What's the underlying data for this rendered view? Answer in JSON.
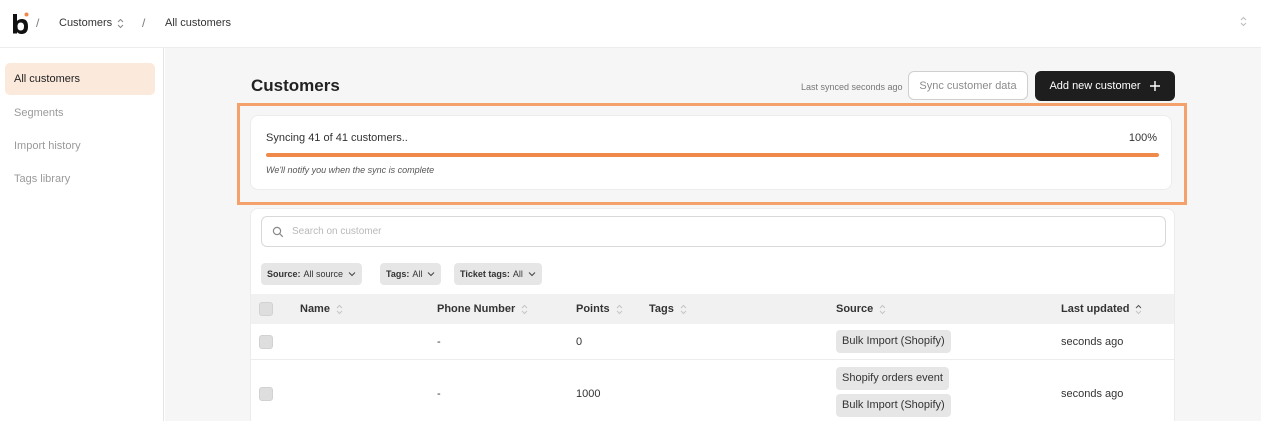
{
  "breadcrumb": {
    "separator": "/",
    "section": "Customers",
    "current": "All customers"
  },
  "colors": {
    "accent": "#f08a4b",
    "highlight": "#f5a16b",
    "sidebar_active_bg": "#fbe9dc",
    "primary_button_bg": "#1e1e1e"
  },
  "sidebar": {
    "items": [
      {
        "label": "All customers",
        "active": true
      },
      {
        "label": "Segments",
        "active": false
      },
      {
        "label": "Import history",
        "active": false
      },
      {
        "label": "Tags library",
        "active": false
      }
    ]
  },
  "header": {
    "title": "Customers",
    "last_synced": "Last synced seconds ago",
    "sync_button": "Sync customer data",
    "add_button": "Add new customer"
  },
  "sync_progress": {
    "label": "Syncing 41 of 41 customers..",
    "percent_text": "100%",
    "fraction": 1.0,
    "note": "We'll notify you when the sync is complete"
  },
  "search": {
    "placeholder": "Search on customer",
    "value": ""
  },
  "filters": [
    {
      "key": "Source:",
      "value": "All source"
    },
    {
      "key": "Tags:",
      "value": "All"
    },
    {
      "key": "Ticket tags:",
      "value": "All"
    }
  ],
  "table": {
    "columns": [
      "Name",
      "Phone Number",
      "Points",
      "Tags",
      "Source",
      "Last updated"
    ],
    "rows": [
      {
        "name": "",
        "phone": "-",
        "points": "0",
        "tags": "",
        "sources": [
          "Bulk Import (Shopify)"
        ],
        "updated": "seconds ago"
      },
      {
        "name": "",
        "phone": "-",
        "points": "1000",
        "tags": "",
        "sources": [
          "Shopify orders event",
          "Bulk Import (Shopify)"
        ],
        "updated": "seconds ago"
      }
    ]
  },
  "icons": {
    "logo": "brand-logo-b",
    "search": "search-icon",
    "plus": "plus-icon",
    "chevron": "chevron-down-icon",
    "sort": "sort-updown-icon"
  }
}
